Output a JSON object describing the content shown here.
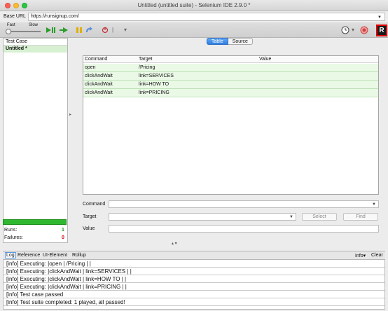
{
  "window": {
    "title": "Untitled (untitled suite) - Selenium IDE 2.9.0 *"
  },
  "base_url": {
    "label": "Base URL",
    "value": "https://runsignup.com/"
  },
  "toolbar": {
    "speed_fast": "Fast",
    "speed_slow": "Slow",
    "icons": [
      "play-suite-icon",
      "play-test-icon",
      "pause-icon",
      "step-icon",
      "rollup-icon",
      "schedule-icon",
      "record-icon",
      "selenium-logo"
    ],
    "logo_letter": "R"
  },
  "test_case_panel": {
    "header": "Test Case",
    "items": [
      {
        "label": "Untitled *",
        "selected": true
      }
    ],
    "runs_label": "Runs:",
    "runs_value": "1",
    "failures_label": "Failures:",
    "failures_value": "0",
    "progress": 1.0
  },
  "view_tabs": {
    "table": "Table",
    "source": "Source",
    "active": "Table"
  },
  "commands_table": {
    "headers": [
      "Command",
      "Target",
      "Value"
    ],
    "rows": [
      {
        "command": "open",
        "target": "/Pricing",
        "value": ""
      },
      {
        "command": "clickAndWait",
        "target": "link=SERVICES",
        "value": ""
      },
      {
        "command": "clickAndWait",
        "target": "link=HOW TO",
        "value": ""
      },
      {
        "command": "clickAndWait",
        "target": "link=PRICING",
        "value": ""
      }
    ]
  },
  "editor": {
    "command_label": "Command",
    "target_label": "Target",
    "value_label": "Value",
    "select_button": "Select",
    "find_button": "Find"
  },
  "log_panel": {
    "tabs": [
      "Log",
      "Reference",
      "UI-Element",
      "Rollup"
    ],
    "active_tab": "Log",
    "info_label": "Info▾",
    "clear_label": "Clear",
    "lines": [
      "[info] Executing: |open | /Pricing | |",
      "[info] Executing: |clickAndWait | link=SERVICES | |",
      "[info] Executing: |clickAndWait | link=HOW TO | |",
      "[info] Executing: |clickAndWait | link=PRICING | |",
      "[info] Test case passed",
      "[info] Test suite completed: 1 played, all passed!"
    ]
  },
  "colors": {
    "accent_blue": "#2f7de0",
    "pass_green": "#2fb82f",
    "row_green": "#eaf8e6",
    "failures_red": "#d00000",
    "runs_green": "#1a8f1a"
  }
}
